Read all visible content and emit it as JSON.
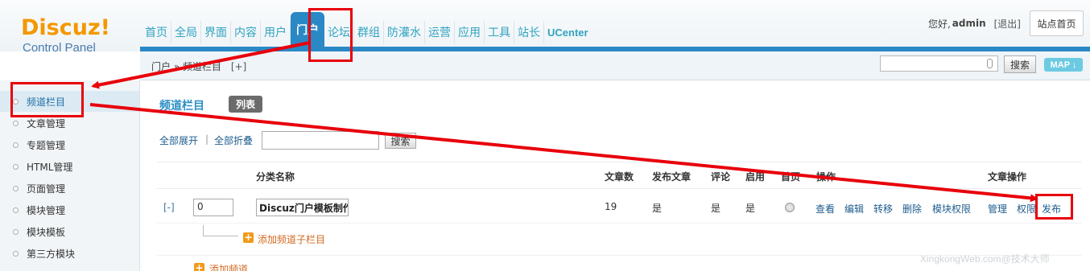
{
  "brand": {
    "logo": "Discuz!",
    "sub": "Control Panel"
  },
  "topnav": [
    {
      "label": "首页"
    },
    {
      "label": "全局"
    },
    {
      "label": "界面"
    },
    {
      "label": "内容"
    },
    {
      "label": "用户"
    },
    {
      "label": "门户",
      "active": true
    },
    {
      "label": "论坛"
    },
    {
      "label": "群组"
    },
    {
      "label": "防灌水"
    },
    {
      "label": "运营"
    },
    {
      "label": "应用"
    },
    {
      "label": "工具"
    },
    {
      "label": "站长"
    },
    {
      "label": "UCenter"
    }
  ],
  "userbar": {
    "greeting": "您好,",
    "username": "admin",
    "logout": "[退出]",
    "site_home": "站点首页"
  },
  "breadcrumb": {
    "path": "门户 » 频道栏目",
    "add": "[+]"
  },
  "header_search": {
    "button": "搜索",
    "map": "MAP ↓"
  },
  "sidebar": {
    "items": [
      {
        "label": "频道栏目",
        "active": true
      },
      {
        "label": "文章管理"
      },
      {
        "label": "专题管理"
      },
      {
        "label": "HTML管理"
      },
      {
        "label": "页面管理"
      },
      {
        "label": "模块管理"
      },
      {
        "label": "模块模板"
      },
      {
        "label": "第三方模块"
      }
    ]
  },
  "main": {
    "title": "频道栏目",
    "list_badge": "列表",
    "expand_all": "全部展开",
    "separator": "|",
    "collapse_all": "全部折叠",
    "search_button": "搜索"
  },
  "table": {
    "headers": {
      "name": "分类名称",
      "articles": "文章数",
      "publish": "发布文章",
      "comment": "评论",
      "enabled": "启用",
      "home": "首页",
      "ops": "操作",
      "article_ops": "文章操作"
    },
    "row": {
      "toggle": "[-]",
      "order": "0",
      "name": "Discuz门户模板制作",
      "articles": "19",
      "publish": "是",
      "comment": "是",
      "enabled": "是",
      "ops": [
        "查看",
        "编辑",
        "转移",
        "删除",
        "模块权限"
      ],
      "article_ops": [
        "管理",
        "权限",
        "发布"
      ]
    },
    "add_sub": "添加频道子栏目",
    "add_channel": "添加频道"
  },
  "watermark": "XingkongWeb.com@技术大师",
  "colors": {
    "accent": "#2a88c5",
    "annotation": "#e8000b",
    "logo": "#f39800"
  }
}
